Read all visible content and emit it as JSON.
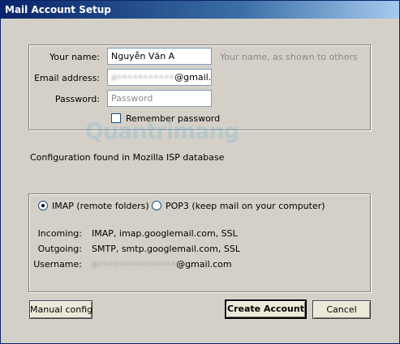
{
  "window": {
    "title": "Mail Account Setup"
  },
  "account": {
    "name_label": "Your name:",
    "name_value": "Nguyễn Văn A",
    "name_hint": "Your name, as shown to others",
    "email_label": "Email address:",
    "email_value_hidden": "a•••••••••••",
    "email_value_domain": "@gmail.com",
    "password_label": "Password:",
    "password_placeholder": "Password",
    "remember_label": "Remember password",
    "remember_checked": false
  },
  "watermark": "Quantrimang",
  "status": {
    "message": "Configuration found in Mozilla ISP database"
  },
  "protocol": {
    "imap_label": "IMAP (remote folders)",
    "pop3_label": "POP3 (keep mail on your computer)",
    "selected": "IMAP"
  },
  "details": {
    "incoming_label": "Incoming:",
    "incoming_value": "IMAP, imap.googlemail.com, SSL",
    "outgoing_label": "Outgoing:",
    "outgoing_value": "SMTP, smtp.googlemail.com, SSL",
    "username_label": "Username:",
    "username_value_hidden": "a•••••••••••••••",
    "username_value_domain": "@gmail.com"
  },
  "buttons": {
    "manual_config": "Manual config",
    "create_account": "Create Account",
    "cancel": "Cancel"
  }
}
